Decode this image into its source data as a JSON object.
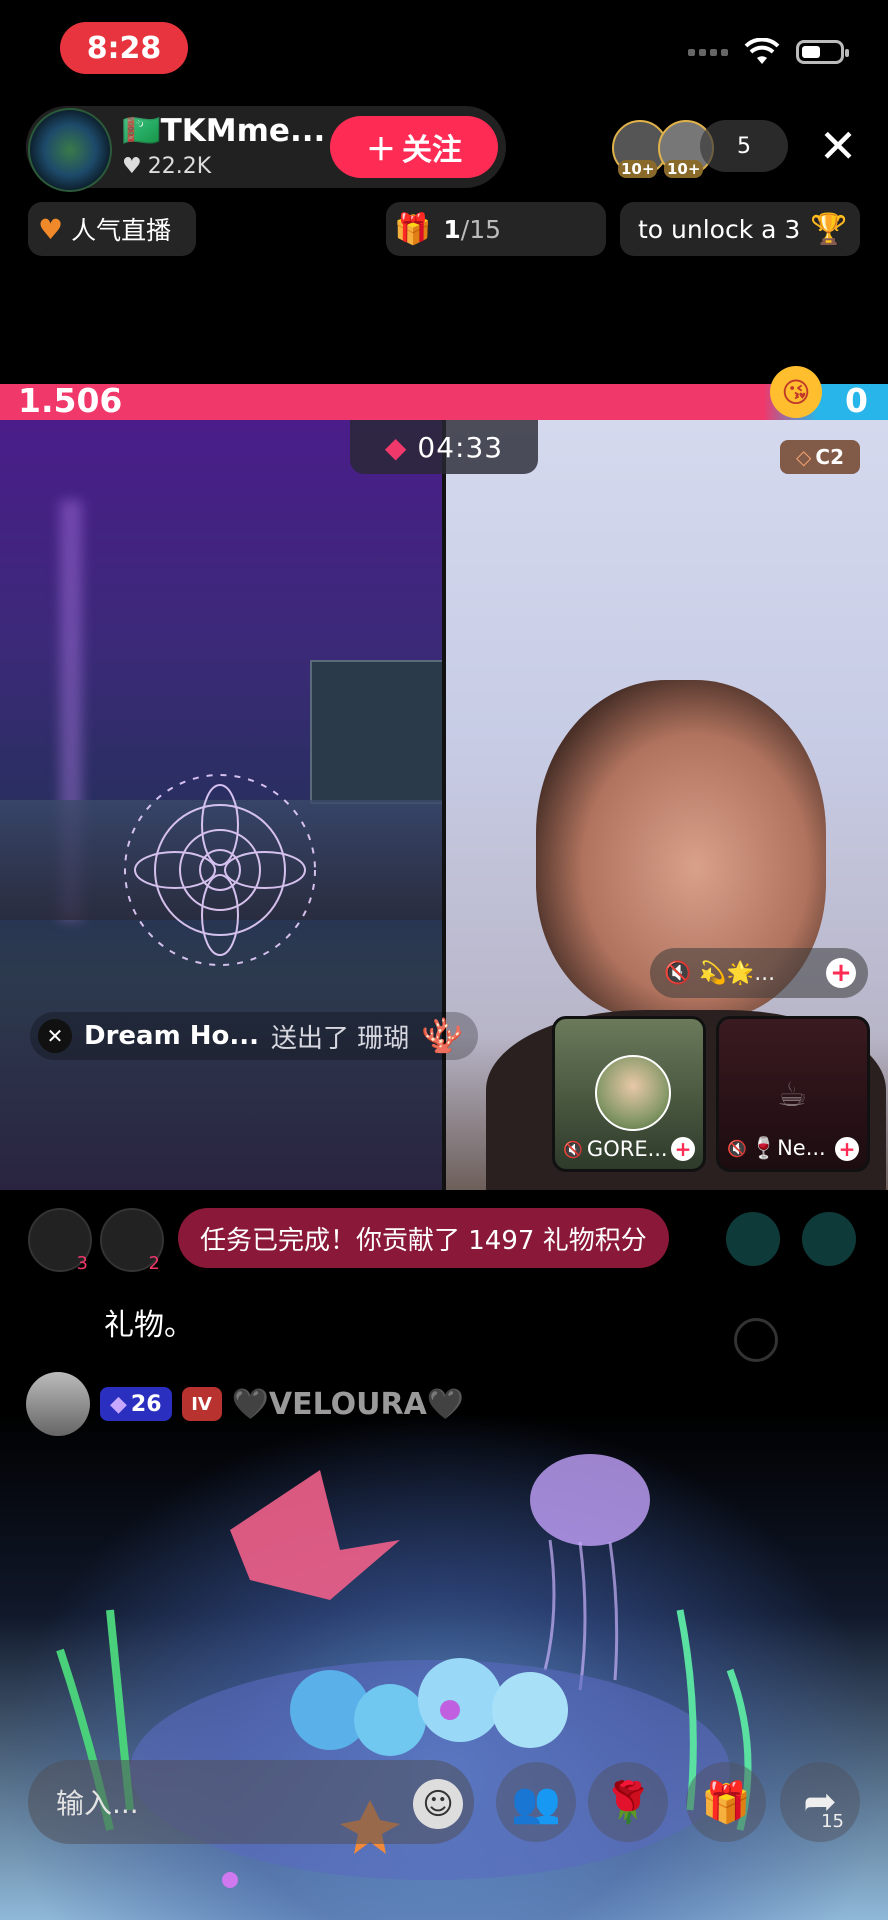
{
  "status_bar": {
    "time": "8:28"
  },
  "host": {
    "name": "🇹🇲TKMme...",
    "likes": "22.2K",
    "follow_label": "关注",
    "viewer_badges": [
      "10+",
      "10+"
    ],
    "viewer_count": "5"
  },
  "chips": {
    "popular": "人气直播",
    "progress_current": "1",
    "progress_total": "/15",
    "unlock": "to unlock a 3"
  },
  "battle": {
    "left_score": "1.506",
    "right_score": "0",
    "timer": "04:33",
    "rank_badge": "C2"
  },
  "left_stream": {
    "gift_sender": "Dream Ho...",
    "gift_action": "送出了 珊瑚"
  },
  "right_stream": {
    "guest_strip_label": "💫🌟...",
    "guests": [
      {
        "name": "GORE..."
      },
      {
        "name": "🍷Ne..."
      }
    ]
  },
  "chat": {
    "seat_counts": [
      "3",
      "2"
    ],
    "task_banner": "任务已完成！你贡献了 1497 礼物积分",
    "comment": "礼物。",
    "user_level": "26",
    "user_badge": "IV",
    "user_name": "🖤VELOURA🖤"
  },
  "toolbar": {
    "input_placeholder": "输入...",
    "share_count": "15"
  },
  "colors": {
    "accent": "#fe2c55",
    "score_left": "#f0386a",
    "score_right": "#28b6ea",
    "time_pill": "#e8343e"
  }
}
